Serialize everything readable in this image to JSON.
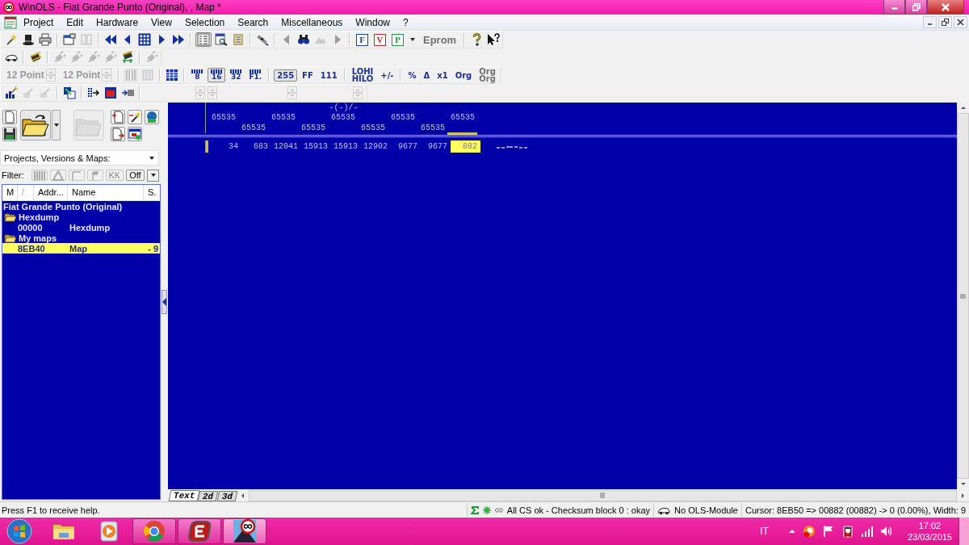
{
  "window": {
    "title": "WinOLS - Fiat Grande Punto (Original), , Map *"
  },
  "menu": [
    "Project",
    "Edit",
    "Hardware",
    "View",
    "Selection",
    "Search",
    "Miscellaneous",
    "Window",
    "?"
  ],
  "toolbars": [
    [
      {
        "kind": "icon",
        "disabled": false
      },
      {
        "kind": "icon",
        "disabled": false
      },
      {
        "kind": "icon",
        "disabled": false
      },
      {
        "kind": "sep"
      },
      {
        "kind": "icon",
        "disabled": false
      },
      {
        "kind": "icon",
        "disabled": true
      },
      {
        "kind": "sep"
      },
      {
        "kind": "icon",
        "disabled": false
      },
      {
        "kind": "icon",
        "disabled": false
      },
      {
        "kind": "icon",
        "disabled": false
      },
      {
        "kind": "icon",
        "disabled": false
      },
      {
        "kind": "icon",
        "disabled": false
      },
      {
        "kind": "sep"
      },
      {
        "kind": "icon",
        "disabled": false,
        "selected": true
      },
      {
        "kind": "icon",
        "disabled": false,
        "selected": false
      },
      {
        "kind": "icon",
        "disabled": false,
        "selected": false
      },
      {
        "kind": "sep"
      },
      {
        "kind": "icon",
        "disabled": false
      },
      {
        "kind": "sep"
      },
      {
        "kind": "icon",
        "disabled": true
      },
      {
        "kind": "icon",
        "disabled": false
      },
      {
        "kind": "icon",
        "disabled": true
      },
      {
        "kind": "icon",
        "disabled": true
      },
      {
        "kind": "sep"
      },
      {
        "kind": "letter",
        "label": "F",
        "color": "#1f3fa8",
        "disabled": false
      },
      {
        "kind": "letter",
        "label": "V",
        "color": "#c0282d",
        "disabled": false
      },
      {
        "kind": "letter",
        "label": "P",
        "color": "#1f9a3a",
        "disabled": false
      },
      {
        "kind": "caret",
        "disabled": false
      },
      {
        "kind": "text",
        "label": "Eprom",
        "disabled": true
      },
      {
        "kind": "sep"
      },
      {
        "kind": "icon",
        "disabled": false
      },
      {
        "kind": "icon",
        "disabled": false
      }
    ],
    [
      {
        "kind": "icon",
        "disabled": false
      },
      {
        "kind": "sep"
      },
      {
        "kind": "icon",
        "disabled": false
      },
      {
        "kind": "sep"
      },
      {
        "kind": "icon",
        "disabled": true
      },
      {
        "kind": "icon",
        "disabled": true
      },
      {
        "kind": "icon",
        "disabled": true
      },
      {
        "kind": "icon",
        "disabled": true
      },
      {
        "kind": "icon",
        "disabled": false
      },
      {
        "kind": "sep"
      },
      {
        "kind": "icon",
        "disabled": true
      }
    ],
    [
      {
        "kind": "spin",
        "label": "12 Point",
        "disabled": true
      },
      {
        "kind": "spin",
        "label": "12 Point",
        "disabled": true
      },
      {
        "kind": "sep"
      },
      {
        "kind": "icon",
        "disabled": true
      },
      {
        "kind": "icon",
        "disabled": true
      },
      {
        "kind": "sep"
      },
      {
        "kind": "icon",
        "disabled": false
      },
      {
        "kind": "sep"
      },
      {
        "kind": "bits",
        "label": "8",
        "disabled": false,
        "selected": false
      },
      {
        "kind": "bits",
        "label": "16",
        "disabled": false,
        "selected": true
      },
      {
        "kind": "bits",
        "label": "32",
        "disabled": false,
        "selected": false
      },
      {
        "kind": "bits",
        "label": "F1.",
        "disabled": false,
        "selected": false
      },
      {
        "kind": "sep"
      },
      {
        "kind": "text",
        "label": "255",
        "disabled": false,
        "selected": true
      },
      {
        "kind": "text",
        "label": "FF",
        "disabled": false,
        "selected": false
      },
      {
        "kind": "text",
        "label": "111",
        "disabled": false,
        "selected": false
      },
      {
        "kind": "sep"
      },
      {
        "kind": "text",
        "label": "LOHI\nHILO",
        "disabled": false
      },
      {
        "kind": "text",
        "label": "+/-",
        "disabled": false
      },
      {
        "kind": "sep"
      },
      {
        "kind": "text",
        "label": "%",
        "disabled": false
      },
      {
        "kind": "text",
        "label": "Δ",
        "disabled": false
      },
      {
        "kind": "text",
        "label": "x1",
        "disabled": false
      },
      {
        "kind": "text",
        "label": "Org",
        "disabled": false
      },
      {
        "kind": "text",
        "label": "Org\nOrg",
        "disabled": true
      }
    ],
    [
      {
        "kind": "icon",
        "disabled": false
      },
      {
        "kind": "icon",
        "disabled": true
      },
      {
        "kind": "icon",
        "disabled": true
      },
      {
        "kind": "sep"
      },
      {
        "kind": "icon",
        "disabled": false
      },
      {
        "kind": "sep"
      },
      {
        "kind": "icon",
        "disabled": false
      },
      {
        "kind": "icon",
        "disabled": false
      },
      {
        "kind": "icon",
        "disabled": false
      },
      {
        "kind": "sep"
      },
      {
        "kind": "spin",
        "disabled": true
      },
      {
        "kind": "spin",
        "disabled": true
      },
      {
        "kind": "spin",
        "disabled": true
      },
      {
        "kind": "spin",
        "disabled": true
      }
    ]
  ],
  "panel": {
    "tools": [
      {
        "disabled": false
      },
      {
        "disabled": false
      },
      {
        "disabled": false
      },
      {
        "disabled": false
      },
      {
        "disabled": true
      },
      {
        "disabled": false
      },
      {
        "disabled": false
      },
      {
        "disabled": false
      },
      {
        "disabled": false
      },
      {
        "disabled": false
      }
    ],
    "selector": {
      "value": "Projects, Versions & Maps:"
    },
    "filter": {
      "label": "Filter:",
      "buttons": [
        {
          "kind": "icon",
          "disabled": true
        },
        {
          "kind": "icon",
          "disabled": true
        },
        {
          "kind": "icon",
          "disabled": true
        },
        {
          "kind": "icon",
          "disabled": true
        },
        {
          "kind": "text",
          "label": "KK",
          "disabled": true
        },
        {
          "kind": "text",
          "label": "Off",
          "disabled": false
        }
      ]
    },
    "columns": [
      "M",
      "/",
      "Addr...",
      "Name",
      "S."
    ],
    "tree": [
      {
        "label": "Fiat Grande Punto (Original)",
        "selected": false,
        "children": [
          {
            "label": "Hexdump",
            "selected": false,
            "children": [
              {
                "address": "00000",
                "name": "Hexdump",
                "selected": false
              }
            ]
          },
          {
            "label": "My maps",
            "selected": false,
            "children": [
              {
                "address": "8EB40",
                "name": "Map",
                "size": "- 9",
                "selected": true
              }
            ]
          }
        ]
      }
    ]
  },
  "map": {
    "title": "-(-)/-",
    "column_headers": [
      "65535",
      "65535",
      "65535",
      "65535",
      "65535",
      "65535",
      "65535",
      "65535",
      "65535"
    ],
    "rows": [
      {
        "cells": [
          {
            "value": "34",
            "selected": false
          },
          {
            "value": "683",
            "selected": false
          },
          {
            "value": "12041",
            "selected": false
          },
          {
            "value": "15913",
            "selected": false
          },
          {
            "value": "15913",
            "selected": false
          },
          {
            "value": "12902",
            "selected": false
          },
          {
            "value": "9677",
            "selected": false
          },
          {
            "value": "9677",
            "selected": false
          },
          {
            "value": "882",
            "selected": true
          }
        ]
      }
    ]
  },
  "view_tabs": [
    {
      "label": "Text",
      "selected": true
    },
    {
      "label": "2d",
      "selected": false
    },
    {
      "label": "3d",
      "selected": false
    }
  ],
  "status_bar": {
    "help": "Press F1 to receive help.",
    "checksum": "All CS ok - Checksum block 0 : okay",
    "module": "No OLS-Module",
    "cursor": "Cursor: 8EB50 => 00882 (00882) -> 0 (0.00%), Width: 9"
  },
  "taskbar": {
    "apps": [
      {
        "open": false
      },
      {
        "open": false
      },
      {
        "open": true
      },
      {
        "open": true
      },
      {
        "open": true,
        "selected": true
      }
    ],
    "language": "IT",
    "time": "17:02",
    "date": "23/03/2015"
  }
}
